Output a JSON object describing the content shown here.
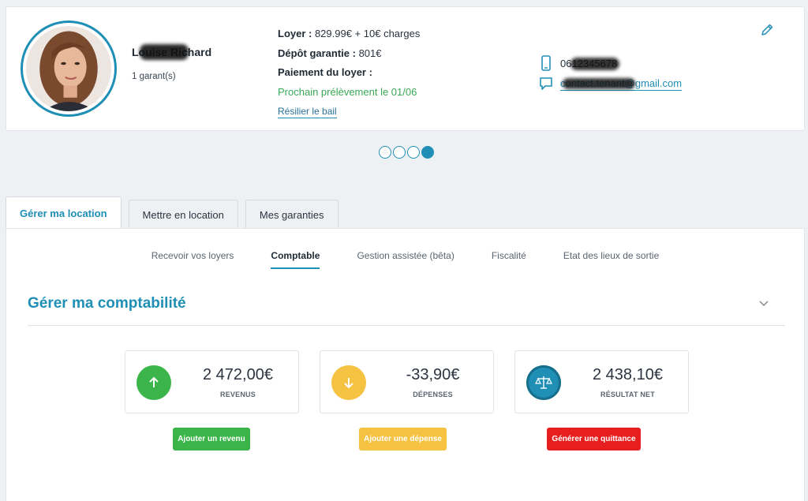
{
  "tenant": {
    "name": "Louise Richard",
    "guarantors": "1 garant(s)",
    "phone": "0612345678",
    "email": "contact.tenant@gmail.com"
  },
  "lease": {
    "rent_label": "Loyer :",
    "rent_value": " 829.99€ + 10€ charges",
    "deposit_label": "Dépôt garantie :",
    "deposit_value": " 801€",
    "payment_label": "Paiement du loyer :",
    "next_debit": "Prochain prélèvement le 01/06",
    "terminate_link": "Résilier le bail"
  },
  "pagination": {
    "count": 4,
    "active_index": 3
  },
  "tabs": [
    {
      "label": "Gérer ma location",
      "active": true
    },
    {
      "label": "Mettre en location",
      "active": false
    },
    {
      "label": "Mes garanties",
      "active": false
    }
  ],
  "subnav": [
    {
      "label": "Recevoir vos loyers",
      "active": false
    },
    {
      "label": "Comptable",
      "active": true
    },
    {
      "label": "Gestion assistée (bêta)",
      "active": false
    },
    {
      "label": "Fiscalité",
      "active": false
    },
    {
      "label": "Etat des lieux de sortie",
      "active": false
    }
  ],
  "section": {
    "title": "Gérer ma comptabilité"
  },
  "stats": [
    {
      "value": "2 472,00€",
      "label": "REVENUS",
      "icon": "arrow-up-icon",
      "color": "#3bb54a"
    },
    {
      "value": "-33,90€",
      "label": "DÉPENSES",
      "icon": "arrow-down-icon",
      "color": "#f5c242"
    },
    {
      "value": "2 438,10€",
      "label": "RÉSULTAT NET",
      "icon": "scale-icon",
      "color": "#1f8fb5"
    }
  ],
  "actions": [
    {
      "label": "Ajouter un revenu",
      "color": "#3bb54a"
    },
    {
      "label": "Ajouter une dépense",
      "color": "#f5c242"
    },
    {
      "label": "Générer une quittance",
      "color": "#e61e1e"
    }
  ],
  "colors": {
    "accent": "#1f8fb5",
    "success": "#39a857"
  }
}
